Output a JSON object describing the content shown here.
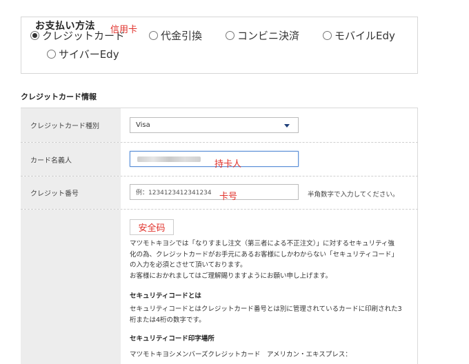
{
  "payment": {
    "title": "お支払い方法",
    "options": [
      {
        "label": "クレジットカード",
        "checked": true
      },
      {
        "label": "代金引換",
        "checked": false
      },
      {
        "label": "コンビニ決済",
        "checked": false
      },
      {
        "label": "モバイルEdy",
        "checked": false
      },
      {
        "label": "サイバーEdy",
        "checked": false
      }
    ],
    "annotation": "信用卡"
  },
  "card_info": {
    "title": "クレジットカード情報",
    "type_label": "クレジットカード種別",
    "type_value": "Visa",
    "holder_label": "カード名義人",
    "holder_annotation": "持卡人",
    "number_label": "クレジット番号",
    "number_placeholder": "例：1234123412341234",
    "number_annotation": "卡号",
    "number_hint": "半角数字で入力してください。",
    "security_annotation": "安全码",
    "security_intro_lines": [
      "マツモトキヨシでは「なりすまし注文（第三者による不正注文）」に対するセキュリティ強",
      "化の為、クレジットカードがお手元にあるお客様にしかわからない「セキュリティコード」",
      "の入力を必須とさせて頂いております。",
      "お客様におかれましてはご理解賜りますようにお願い申し上げます。"
    ],
    "security_what_title": "セキュリティコードとは",
    "security_what_lines": [
      "セキュリティコードとはクレジットカード番号とは別に管理されているカードに印刷された3",
      "桁または4桁の数字です。"
    ],
    "security_where_title": "セキュリティコード印字場所",
    "security_where_line": "マツモトキヨシメンバーズクレジットカード　アメリカン・エキスプレス："
  }
}
